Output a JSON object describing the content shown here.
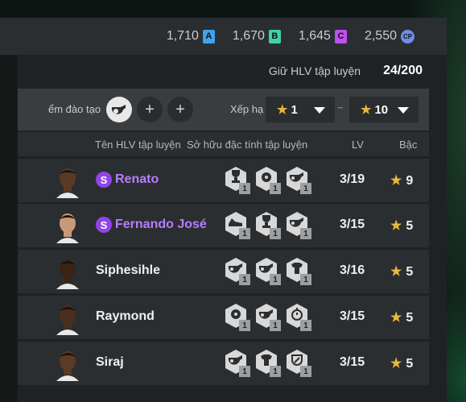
{
  "currencies": [
    {
      "value": "1,710",
      "badge": "A",
      "color": "#3fa3f0"
    },
    {
      "value": "1,670",
      "badge": "B",
      "color": "#3fd1a8"
    },
    {
      "value": "1,645",
      "badge": "C",
      "color": "#c24ef0"
    },
    {
      "value": "2,550",
      "badge": "CP",
      "color": "#6d8fe8"
    }
  ],
  "coach_limit": {
    "label": "Giữ HLV tập luyện",
    "count": "24/200"
  },
  "filter": {
    "label": "ểm đào tạo",
    "add_symbol": "+",
    "rank_label": "Xếp hạ",
    "rank_from": "1",
    "rank_to": "10",
    "tilde": "~",
    "star": "★"
  },
  "table": {
    "headers": {
      "name": "Tên HLV tập luyện",
      "traits": "Sở hữu đặc tính tập luyện",
      "lv": "LV",
      "grade": "Bậc"
    },
    "rows": [
      {
        "name": "Renato",
        "special": true,
        "special_badge": "S",
        "traits": [
          "trophy-icon",
          "ball-icon",
          "whistle-icon"
        ],
        "trait_level": "1",
        "lv": "3/19",
        "grade": "9",
        "skin": "#5a3a26"
      },
      {
        "name": "Fernando José",
        "special": true,
        "special_badge": "S",
        "traits": [
          "shoe-icon",
          "trophy-icon",
          "whistle-icon"
        ],
        "trait_level": "1",
        "lv": "3/15",
        "grade": "5",
        "skin": "#c89a78"
      },
      {
        "name": "Siphesihle",
        "special": false,
        "special_badge": "",
        "traits": [
          "whistle-icon",
          "whistle-icon",
          "shirt-icon"
        ],
        "trait_level": "1",
        "lv": "3/16",
        "grade": "5",
        "skin": "#3a2416"
      },
      {
        "name": "Raymond",
        "special": false,
        "special_badge": "",
        "traits": [
          "ball-icon",
          "whistle-icon",
          "stopwatch-icon"
        ],
        "trait_level": "1",
        "lv": "3/15",
        "grade": "5",
        "skin": "#4a2e1e"
      },
      {
        "name": "Siraj",
        "special": false,
        "special_badge": "",
        "traits": [
          "whistle-icon",
          "shirt-icon",
          "shield-icon"
        ],
        "trait_level": "1",
        "lv": "3/15",
        "grade": "5",
        "skin": "#5b3a26"
      }
    ]
  }
}
